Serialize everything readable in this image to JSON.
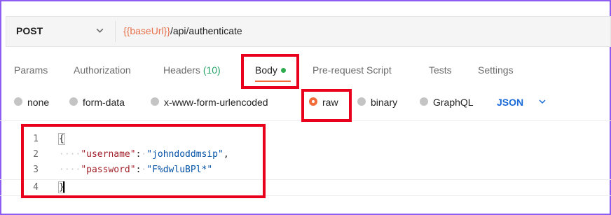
{
  "request": {
    "method": "POST",
    "url_variable": "{{baseUrl}}",
    "url_path": "/api/authenticate"
  },
  "tabs": [
    {
      "label": "Params"
    },
    {
      "label": "Authorization"
    },
    {
      "label": "Headers",
      "count": "(10)"
    },
    {
      "label": "Body",
      "active": true
    },
    {
      "label": "Pre-request Script"
    },
    {
      "label": "Tests"
    },
    {
      "label": "Settings"
    }
  ],
  "body_types": [
    {
      "label": "none"
    },
    {
      "label": "form-data"
    },
    {
      "label": "x-www-form-urlencoded"
    },
    {
      "label": "raw",
      "selected": true
    },
    {
      "label": "binary"
    },
    {
      "label": "GraphQL"
    }
  ],
  "language": "JSON",
  "editor": {
    "line_numbers": [
      "1",
      "2",
      "3",
      "4"
    ],
    "open_brace": "{",
    "close_brace": "}",
    "indent": "····",
    "fields": [
      {
        "key": "\"username\"",
        "colon": ":",
        "value": "\"johndoddmsip\"",
        "comma": ","
      },
      {
        "key": "\"password\"",
        "colon": ":",
        "value": "\"F%dwluBPl*\"",
        "comma": ""
      }
    ]
  },
  "colors": {
    "accent": "#f26b3a",
    "highlight_box": "#e8001c",
    "frame": "#8d5cf2",
    "url_variable": "#e8724d",
    "json_key": "#a3212b",
    "json_value": "#0451a5",
    "language_link": "#1a6ad8"
  }
}
